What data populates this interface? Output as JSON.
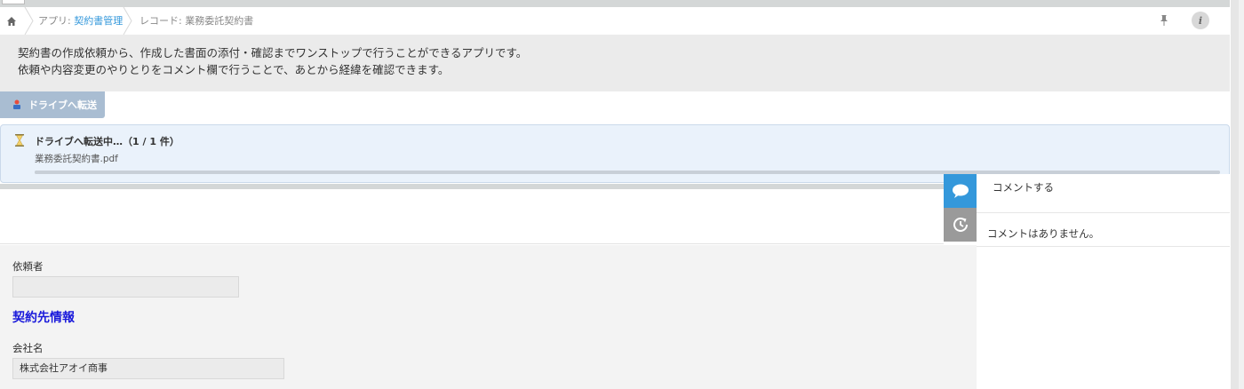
{
  "breadcrumb": {
    "app_prefix": "アプリ: ",
    "app_name": "契約書管理",
    "record": "レコード: 業務委託契約書"
  },
  "description": {
    "line1": "契約書の作成依頼から、作成した書面の添付・確認までワンストップで行うことができるアプリです。",
    "line2": "依頼や内容変更のやりとりをコメント欄で行うことで、あとから経緯を確認できます。"
  },
  "drive_button": {
    "label": "ドライブへ転送"
  },
  "transfer": {
    "title": "ドライブへ転送中…（1 / 1 件）",
    "file": "業務委託契約書.pdf",
    "progress": 1.0
  },
  "form": {
    "requester_label": "依頼者",
    "requester_value": "",
    "section_title": "契約先情報",
    "company_label": "会社名",
    "company_value": "株式会社アオイ商事"
  },
  "comments": {
    "placeholder": "コメントする",
    "empty_text": "コメントはありません。"
  },
  "colors": {
    "link": "#3498db",
    "section_title": "#1a1adb",
    "comment_tab": "#3498db",
    "history_tab": "#9a9a9a",
    "drive_button": "#a9bdd2"
  },
  "icons": {
    "home": "home-icon",
    "pin": "pin-icon",
    "info": "info-icon",
    "drive": "drive-upload-icon",
    "hourglass": "hourglass-icon",
    "comment": "comment-bubble-icon",
    "history": "history-icon"
  }
}
